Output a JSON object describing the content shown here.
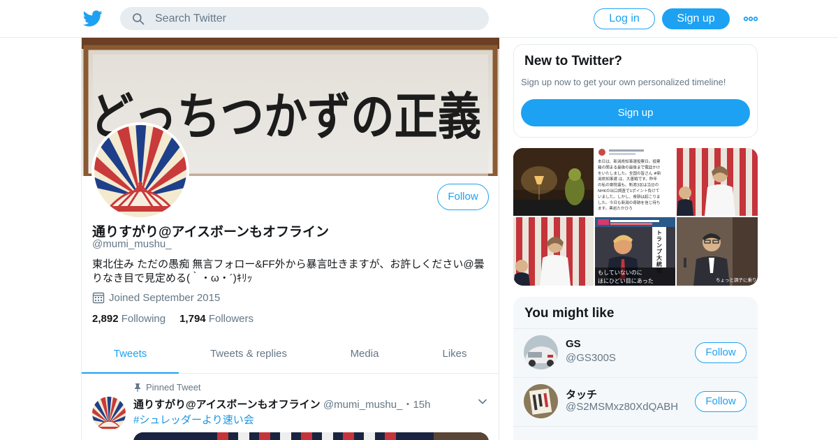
{
  "header": {
    "logo_icon": "twitter-bird-icon",
    "search_placeholder": "Search Twitter",
    "login_label": "Log in",
    "signup_label": "Sign up",
    "more_icon": "more-dots-icon",
    "brand_color": "#1da1f2"
  },
  "profile": {
    "banner_text": "どっちつかずの正義",
    "display_name": "通りすがり@アイスボーンもオフライン",
    "handle": "@mumi_mushu_",
    "follow_label": "Follow",
    "bio": "東北住み ただの愚痴 無言フォロー&FF外から暴言吐きますが、お許しください@曇りなき目で見定める(｀・ω・´)ｷﾘｯ",
    "joined": "Joined September 2015",
    "following_count": "2,892",
    "following_label": "Following",
    "followers_count": "1,794",
    "followers_label": "Followers"
  },
  "tabs": [
    {
      "label": "Tweets",
      "active": true
    },
    {
      "label": "Tweets & replies",
      "active": false
    },
    {
      "label": "Media",
      "active": false
    },
    {
      "label": "Likes",
      "active": false
    }
  ],
  "pinned_tweet": {
    "pinned_label": "Pinned Tweet",
    "author_name": "通りすがり@アイスボーンもオフライン",
    "author_handle": "@mumi_mushu_",
    "time": "・15h",
    "hashtag": "#シュレッダーより速い会"
  },
  "new_to_twitter": {
    "title": "New to Twitter?",
    "subtitle": "Sign up now to get your own personalized timeline!",
    "signup_label": "Sign up"
  },
  "media_grid": {
    "tweet_text_lines": [
      "本日は、新潟県知事選投票日。投票",
      "箱の閉まる最後の最後まで電話かけ",
      "をいたしました。全国の皆さん #新",
      "潟県知事選 は、大善戦です。昨年",
      "の私の衆院選も、新潟3区は当日の",
      "NHKの出口調査で1ポイント負けて",
      "いました。しかし、奇跡は起こりま",
      "した。今日も新潟の奇跡を信じ待ち",
      "ます。黒岩たかひろ"
    ],
    "tv_caption_1": "トランプ大統領",
    "tv_caption_2a": "もしていないのに",
    "tv_caption_2b": "ほにひどい目にあった",
    "tv_caption_3": "ちょっと調子に乗りまして"
  },
  "you_might_like": {
    "title": "You might like",
    "users": [
      {
        "name": "GS",
        "handle": "@GS300S",
        "follow_label": "Follow"
      },
      {
        "name": "タッチ",
        "handle": "@S2MSMxz80XdQABH",
        "follow_label": "Follow"
      }
    ]
  }
}
